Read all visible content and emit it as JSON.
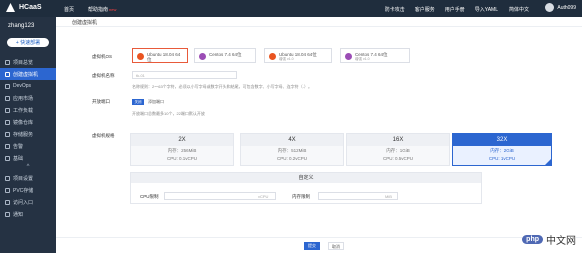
{
  "header": {
    "logo_text": "HCaaS",
    "nav": [
      "首页",
      "帮助指南"
    ],
    "nav_badge": "new",
    "links": [
      "防卡攻击",
      "客户服务",
      "用户手册"
    ],
    "yaml_label": "导入YAML",
    "lang_label": "简体中文",
    "user_label": "Auth099"
  },
  "sidebar": {
    "username": "zhang123",
    "quick_button": "+ 快速部署",
    "items": [
      {
        "label": "项目总览"
      },
      {
        "label": "创建虚拟机"
      },
      {
        "label": "DevOps"
      },
      {
        "label": "应用市场"
      },
      {
        "label": "工作负载"
      },
      {
        "label": "镜像仓库"
      },
      {
        "label": "存储服务"
      },
      {
        "label": "告警"
      },
      {
        "label": "基础"
      },
      {
        "label": "项目设置"
      },
      {
        "label": "PVC存储"
      },
      {
        "label": "访问入口"
      },
      {
        "label": "通知"
      }
    ],
    "active_index": 1
  },
  "page": {
    "breadcrumb": "创建虚拟机",
    "os_label": "虚拟机OS",
    "os_options": [
      {
        "name": "Ubuntu 18.04 64位",
        "sub": "",
        "color": "#e95420",
        "selected": true
      },
      {
        "name": "Centos 7.4 64位",
        "sub": "",
        "color": "#9b4db5",
        "selected": false
      },
      {
        "name": "Ubuntu 18.04 64位",
        "sub": "增强 v1.0",
        "color": "#e95420",
        "selected": false
      },
      {
        "name": "Centos 7.4 64位",
        "sub": "增强 v1.0",
        "color": "#9b4db5",
        "selected": false
      }
    ],
    "name_label": "虚拟机名称",
    "name_value": "tk-01",
    "name_tip": "名称规则：2～63个字符，必须以小写字母或数字开头和结尾，可包含数字、小写字母、连字符（-）。",
    "port_label": "开放端口",
    "port_toggle": "关闭",
    "port_toggle_text": "添加端口",
    "port_tip": "开放端口总数最多10个，22端口默认开放",
    "spec_label": "虚拟机规格",
    "specs": [
      {
        "title": "2X",
        "mem": "内存：256MiB",
        "cpu": "CPU: 0.1vCPU",
        "selected": false
      },
      {
        "title": "4X",
        "mem": "内存：512MiB",
        "cpu": "CPU: 0.2vCPU",
        "selected": false
      },
      {
        "title": "16X",
        "mem": "内存：1GiB",
        "cpu": "CPU: 0.5vCPU",
        "selected": false
      },
      {
        "title": "32X",
        "mem": "内存：2GiB",
        "cpu": "CPU: 1vCPU",
        "selected": true
      }
    ],
    "custom_title": "自定义",
    "cpu_label": "CPU限制",
    "cpu_unit": "vCPU",
    "mem_label": "内存限制",
    "mem_unit": "MiB",
    "submit": "提交",
    "cancel": "取消"
  },
  "brand": {
    "badge": "php",
    "text": "中文网"
  }
}
